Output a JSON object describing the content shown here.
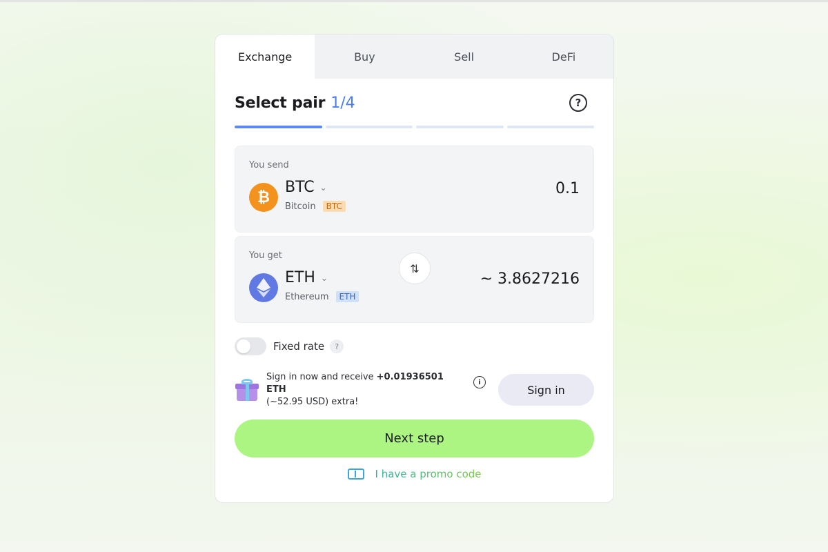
{
  "tabs": [
    {
      "label": "Exchange",
      "active": true
    },
    {
      "label": "Buy",
      "active": false
    },
    {
      "label": "Sell",
      "active": false
    },
    {
      "label": "DeFi",
      "active": false
    }
  ],
  "step": {
    "title": "Select pair",
    "count": "1/4",
    "help_icon": "question-circle-icon",
    "progress": {
      "current": 1,
      "total": 4
    }
  },
  "send": {
    "label": "You send",
    "ticker": "BTC",
    "name": "Bitcoin",
    "badge": "BTC",
    "amount": "0.1",
    "logo_icon": "bitcoin-icon",
    "logo_glyph": "₿",
    "color": "#f3921d"
  },
  "swap_icon": "swap-arrows-icon",
  "get": {
    "label": "You get",
    "ticker": "ETH",
    "name": "Ethereum",
    "badge": "ETH",
    "amount": "~ 3.8627216",
    "logo_icon": "ethereum-icon",
    "color": "#6179e3"
  },
  "fixed_rate": {
    "label": "Fixed rate",
    "enabled": false,
    "help": "?"
  },
  "signin_promo": {
    "text_prefix": "Sign in now and receive ",
    "bonus": "+0.01936501 ETH",
    "text_line2": "(~52.95 USD) extra!",
    "info": "i",
    "button_label": "Sign in"
  },
  "next_button_label": "Next step",
  "promo_code_label": "I have a promo code",
  "colors": {
    "accent_blue": "#5a8af0",
    "next_button": "#acf583",
    "btc": "#f3921d",
    "eth": "#6179e3"
  }
}
